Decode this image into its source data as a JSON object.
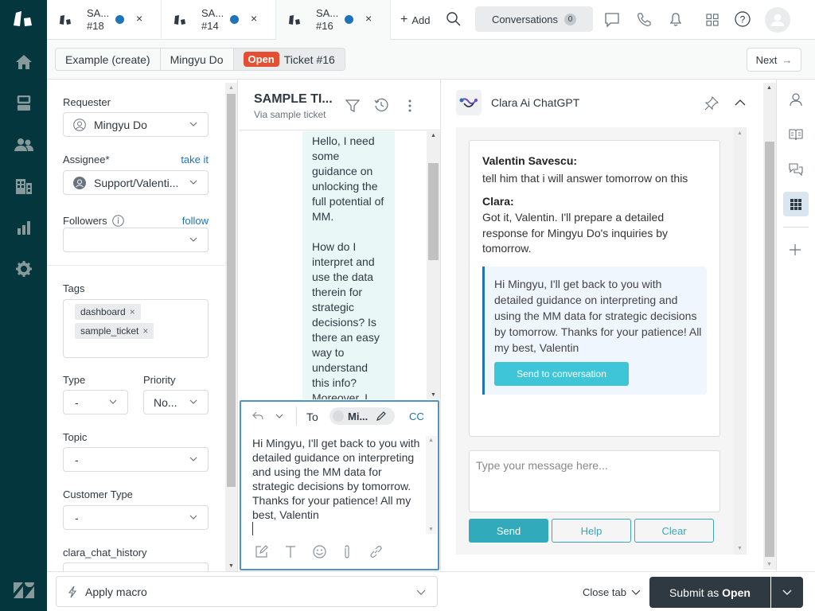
{
  "nav": {
    "items": [
      "logo-icon",
      "home-icon",
      "views-icon",
      "customers-icon",
      "organizations-icon",
      "reporting-icon",
      "admin-icon"
    ],
    "bottom_logo": "zendesk-logo-icon"
  },
  "tabs": [
    {
      "title": "SA...",
      "number": "#18",
      "close": "×"
    },
    {
      "title": "SA...",
      "number": "#14",
      "close": "×"
    },
    {
      "title": "SA...",
      "number": "#16",
      "close": "×"
    }
  ],
  "topbar": {
    "add_label": "Add",
    "conversations_label": "Conversations",
    "conversations_count": "0"
  },
  "breadcrumb": {
    "items": [
      "Example (create)",
      "Mingyu Do"
    ],
    "status_badge": "Open",
    "ticket": "Ticket #16",
    "next_label": "Next"
  },
  "fields": {
    "requester_label": "Requester",
    "requester_value": "Mingyu Do",
    "assignee_label": "Assignee*",
    "assignee_link": "take it",
    "assignee_value": "Support/Valenti...",
    "followers_label": "Followers",
    "followers_link": "follow",
    "tags_label": "Tags",
    "tags": [
      "dashboard",
      "sample_ticket"
    ],
    "type_label": "Type",
    "type_value": "-",
    "priority_label": "Priority",
    "priority_value": "No...",
    "topic_label": "Topic",
    "topic_value": "-",
    "customer_type_label": "Customer Type",
    "customer_type_value": "-",
    "clara_history_label": "clara_chat_history"
  },
  "conversation": {
    "title": "SAMPLE TI...",
    "subtitle": "Via sample ticket",
    "message_p1": "Hello, I need some guidance on unlocking the full potential of MM.",
    "message_p2": "How do I interpret and use the data therein for strategic decisions? Is there an easy way to understand this info? Moreover, I"
  },
  "composer": {
    "to_label": "To",
    "recipient": "Mi...",
    "cc_label": "CC",
    "body": "Hi Mingyu, I'll get back to you with detailed guidance on interpreting and using the MM data for strategic decisions by tomorrow. Thanks for your patience! All my best, Valentin"
  },
  "clara": {
    "app_title": "Clara Ai ChatGPT",
    "messages": [
      {
        "author": "Valentin Savescu:",
        "text": "tell him that i will answer tomorrow on this"
      },
      {
        "author": "Clara:",
        "text": "Got it, Valentin. I'll prepare a detailed response for Mingyu Do's inquiries by tomorrow."
      }
    ],
    "suggestion": "Hi Mingyu, I'll get back to you with detailed guidance on interpreting and using the MM data for strategic decisions by tomorrow. Thanks for your patience! All my best, Valentin",
    "send_to_conversation_label": "Send to conversation",
    "input_placeholder": "Type your message here...",
    "send_label": "Send",
    "help_label": "Help",
    "clear_label": "Clear",
    "colors": {
      "accent": "#31abbc",
      "suggestion_bar": "#1f73b7",
      "send_to_conv": "#3ec6d8"
    }
  },
  "bottom": {
    "macro_label": "Apply macro",
    "close_tab_label": "Close tab",
    "submit_prefix": "Submit as",
    "submit_status": "Open"
  }
}
